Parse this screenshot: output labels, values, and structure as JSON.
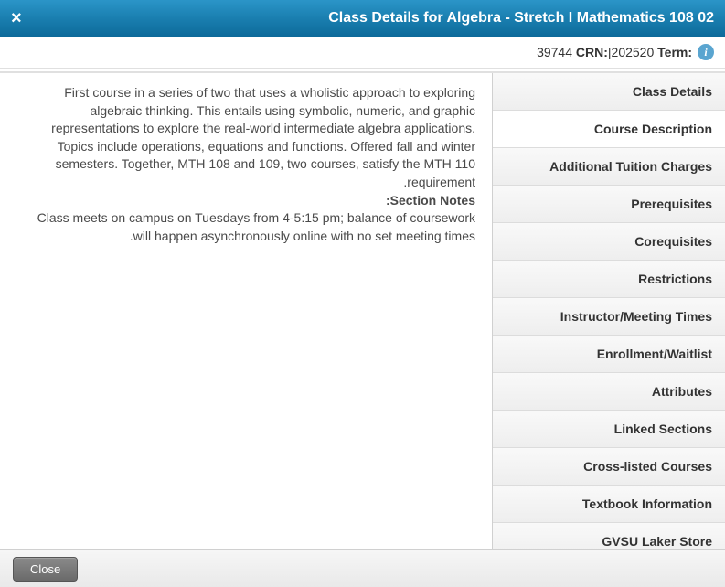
{
  "header": {
    "title": "Class Details for Algebra - Stretch I Mathematics 108 02",
    "close_x": "×"
  },
  "info": {
    "term_label": "Term:",
    "term_value": "202520",
    "crn_label": "CRN:",
    "crn_value": "39744",
    "separator": " | "
  },
  "tabs": [
    {
      "label": "Class Details"
    },
    {
      "label": "Course Description"
    },
    {
      "label": "Additional Tuition Charges"
    },
    {
      "label": "Prerequisites"
    },
    {
      "label": "Corequisites"
    },
    {
      "label": "Restrictions"
    },
    {
      "label": "Instructor/Meeting Times"
    },
    {
      "label": "Enrollment/Waitlist"
    },
    {
      "label": "Attributes"
    },
    {
      "label": "Linked Sections"
    },
    {
      "label": "Cross-listed Courses"
    },
    {
      "label": "Textbook Information"
    },
    {
      "label": "GVSU Laker Store"
    }
  ],
  "detail": {
    "description": "First course in a series of two that uses a wholistic approach to exploring algebraic thinking. This entails using symbolic, numeric, and graphic representations to explore the real-world intermediate algebra applications. Topics include operations, equations and functions. Offered fall and winter semesters. Together, MTH 108 and 109, two courses, satisfy the MTH 110 requirement.",
    "section_notes_label": "Section Notes:",
    "section_notes": "Class meets on campus on Tuesdays from 4-5:15 pm; balance of coursework will happen asynchronously online with no set meeting times."
  },
  "footer": {
    "close_label": "Close"
  }
}
